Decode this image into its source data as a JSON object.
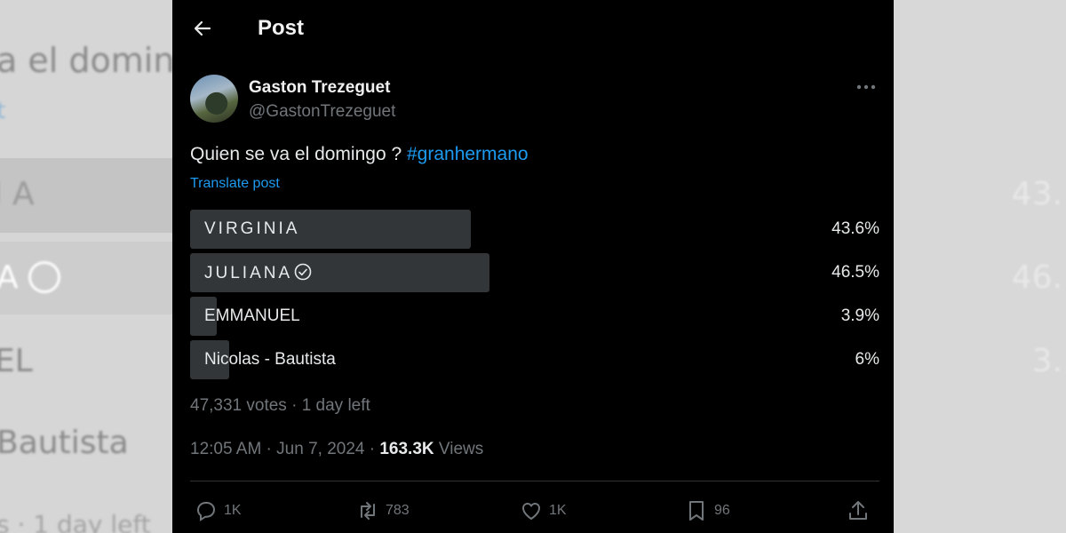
{
  "background": {
    "left_texts": [
      "a el domin",
      "t",
      "I A",
      "A",
      "EL",
      "Bautista",
      "s · 1 day left"
    ],
    "right_texts": [
      "43.",
      "46.",
      "3."
    ]
  },
  "header": {
    "title": "Post",
    "back_icon": "arrow-left-icon"
  },
  "author": {
    "name": "Gaston Trezeguet",
    "handle": "@GastonTrezeguet"
  },
  "post": {
    "text": "Quien se va el domingo ? ",
    "hashtag": "#granhermano",
    "translate_label": "Translate post"
  },
  "poll": {
    "options": [
      {
        "label": "VIRGINIA",
        "percent_text": "43.6%",
        "percent": 43.6,
        "leading": false
      },
      {
        "label": "JULIANA",
        "percent_text": "46.5%",
        "percent": 46.5,
        "leading": true
      },
      {
        "label": "EMMANUEL",
        "percent_text": "3.9%",
        "percent": 3.9,
        "leading": false
      },
      {
        "label": "Nicolas - Bautista",
        "percent_text": "6%",
        "percent": 6,
        "leading": false
      }
    ],
    "meta": "47,331 votes · 1 day left"
  },
  "timestamp": {
    "time": "12:05 AM · Jun 7, 2024 · ",
    "views": "163.3K",
    "views_label": " Views"
  },
  "actions": {
    "reply": "1K",
    "retweet": "783",
    "like": "1K",
    "bookmark": "96"
  },
  "colors": {
    "accent": "#1d9bf0",
    "bar": "#333639",
    "muted": "#71767b",
    "background": "#000000"
  }
}
